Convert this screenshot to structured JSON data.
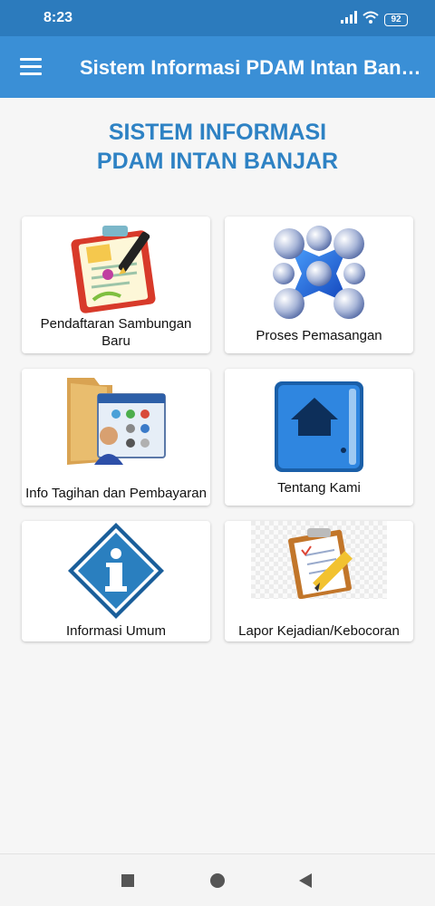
{
  "status_bar": {
    "time": "8:23",
    "battery": "92"
  },
  "app_bar": {
    "title": "Sistem Informasi PDAM Intan Banjar"
  },
  "heading": {
    "line1": "SISTEM INFORMASI",
    "line2": "PDAM INTAN BANJAR"
  },
  "menu": {
    "items": [
      {
        "label": "Pendaftaran Sambungan Baru",
        "icon": "registration-form-icon"
      },
      {
        "label": "Proses Pemasangan",
        "icon": "connected-molecule-icon"
      },
      {
        "label": "Info Tagihan dan Pembayaran",
        "icon": "billing-folder-icon"
      },
      {
        "label": "Tentang Kami",
        "icon": "home-book-icon"
      },
      {
        "label": "Informasi Umum",
        "icon": "info-diamond-icon"
      },
      {
        "label": "Lapor Kejadian/Kebocoran",
        "icon": "report-clipboard-icon"
      }
    ]
  },
  "nav_bar": {
    "buttons": [
      "recent-apps",
      "home",
      "back"
    ]
  },
  "colors": {
    "app_bar": "#3a8fd6",
    "status_bar": "#2c7bbd",
    "heading": "#2e82c4"
  }
}
